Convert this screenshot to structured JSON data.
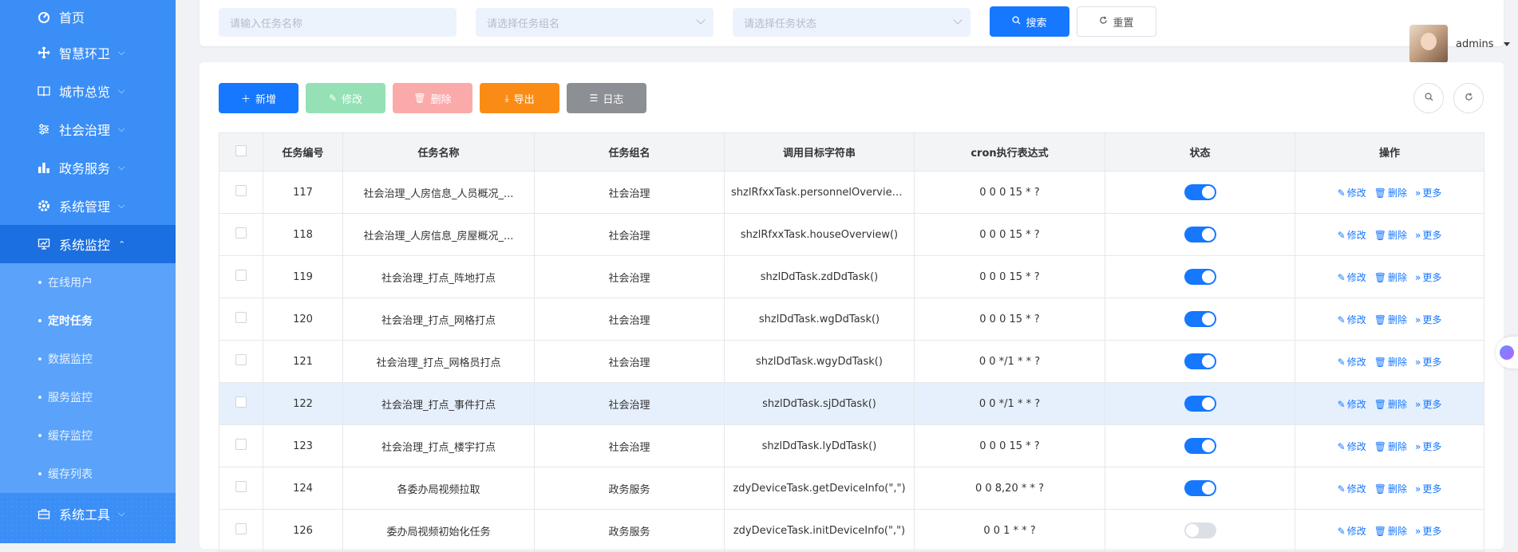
{
  "sidebar": {
    "items": [
      {
        "label": "首页",
        "icon": "dashboard-icon"
      },
      {
        "label": "智慧环卫",
        "icon": "move-icon",
        "chevron": "⌵"
      },
      {
        "label": "城市总览",
        "icon": "book-icon",
        "chevron": "⌵"
      },
      {
        "label": "社会治理",
        "icon": "sliders-icon",
        "chevron": "⌵"
      },
      {
        "label": "政务服务",
        "icon": "bar-chart-icon",
        "chevron": "⌵"
      },
      {
        "label": "系统管理",
        "icon": "gear-icon",
        "chevron": "⌵"
      },
      {
        "label": "系统监控",
        "icon": "monitor-icon",
        "chevron": "⌃"
      },
      {
        "label": "系统工具",
        "icon": "toolbox-icon",
        "chevron": "⌵"
      }
    ],
    "sub_items": [
      "在线用户",
      "定时任务",
      "数据监控",
      "服务监控",
      "缓存监控",
      "缓存列表"
    ]
  },
  "search": {
    "task_name_placeholder": "请输入任务名称",
    "task_group_placeholder": "请选择任务组名",
    "task_status_placeholder": "请选择任务状态",
    "search_label": "搜索",
    "reset_label": "重置"
  },
  "user": {
    "name": "admins"
  },
  "toolbar": {
    "add_label": "新增",
    "edit_label": "修改",
    "delete_label": "删除",
    "export_label": "导出",
    "log_label": "日志"
  },
  "table": {
    "headers": [
      "任务编号",
      "任务名称",
      "任务组名",
      "调用目标字符串",
      "cron执行表达式",
      "状态",
      "操作"
    ],
    "op_labels": [
      "修改",
      "删除",
      "更多"
    ],
    "rows": [
      {
        "id": "117",
        "name": "社会治理_人房信息_人员概况_...",
        "group": "社会治理",
        "target": "shzlRfxxTask.personnelOverview()",
        "cron": "0 0 0 15 * ?",
        "enabled": true
      },
      {
        "id": "118",
        "name": "社会治理_人房信息_房屋概况_...",
        "group": "社会治理",
        "target": "shzlRfxxTask.houseOverview()",
        "cron": "0 0 0 15 * ?",
        "enabled": true
      },
      {
        "id": "119",
        "name": "社会治理_打点_阵地打点",
        "group": "社会治理",
        "target": "shzlDdTask.zdDdTask()",
        "cron": "0 0 0 15 * ?",
        "enabled": true
      },
      {
        "id": "120",
        "name": "社会治理_打点_网格打点",
        "group": "社会治理",
        "target": "shzlDdTask.wgDdTask()",
        "cron": "0 0 0 15 * ?",
        "enabled": true
      },
      {
        "id": "121",
        "name": "社会治理_打点_网格员打点",
        "group": "社会治理",
        "target": "shzlDdTask.wgyDdTask()",
        "cron": "0 0 */1 * * ?",
        "enabled": true
      },
      {
        "id": "122",
        "name": "社会治理_打点_事件打点",
        "group": "社会治理",
        "target": "shzlDdTask.sjDdTask()",
        "cron": "0 0 */1 * * ?",
        "enabled": true
      },
      {
        "id": "123",
        "name": "社会治理_打点_楼宇打点",
        "group": "社会治理",
        "target": "shzlDdTask.lyDdTask()",
        "cron": "0 0 0 15 * ?",
        "enabled": true
      },
      {
        "id": "124",
        "name": "各委办局视频拉取",
        "group": "政务服务",
        "target": "zdyDeviceTask.getDeviceInfo(\",\")",
        "cron": "0 0 8,20 * * ?",
        "enabled": true
      },
      {
        "id": "126",
        "name": "委办局视频初始化任务",
        "group": "政务服务",
        "target": "zdyDeviceTask.initDeviceInfo(\",\")",
        "cron": "0 0 1 * * ?",
        "enabled": false
      }
    ]
  }
}
